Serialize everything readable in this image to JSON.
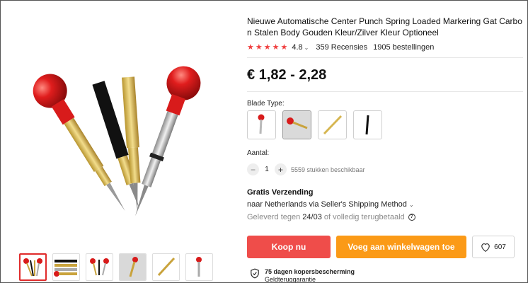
{
  "product": {
    "title": "Nieuwe Automatische Center Punch Spring Loaded Markering Gat Carbon Stalen Body Gouden Kleur/Zilver Kleur Optioneel",
    "rating": "4.8",
    "reviews": "359 Recensies",
    "orders": "1905 bestellingen",
    "price": "€ 1,82 - 2,28"
  },
  "colors": {
    "accent_red": "#ef4d4a",
    "cart_orange": "#fb9a17",
    "star_red": "#f04040"
  },
  "variants": {
    "label": "Blade Type:",
    "items": [
      {
        "name": "red-single"
      },
      {
        "name": "red-side"
      },
      {
        "name": "gold"
      },
      {
        "name": "black"
      }
    ]
  },
  "quantity": {
    "label": "Aantal:",
    "value": "1",
    "available": "5559 stukken beschikbaar"
  },
  "shipping": {
    "title": "Gratis Verzending",
    "to": "naar Netherlands via Seller's Shipping Method",
    "delivery_prefix": "Geleverd tegen",
    "delivery_date": "24/03",
    "delivery_suffix": "of volledig terugbetaald"
  },
  "actions": {
    "buy": "Koop nu",
    "cart": "Voeg aan winkelwagen toe",
    "wishlist_count": "607"
  },
  "protection": {
    "title": "75 dagen kopersbescherming",
    "subtitle": "Geldteruggarantie"
  },
  "icons": [
    "star-icon",
    "chevron-down-icon",
    "minus-icon",
    "plus-icon",
    "question-icon",
    "heart-icon",
    "shield-check-icon"
  ]
}
